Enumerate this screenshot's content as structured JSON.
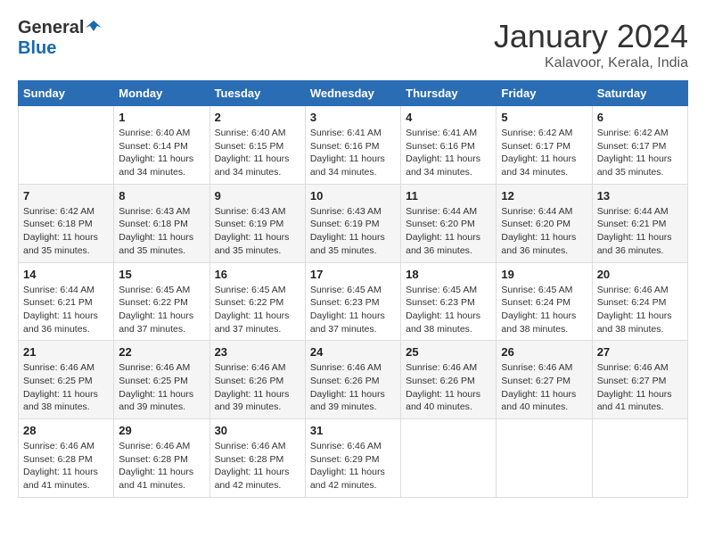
{
  "header": {
    "logo_general": "General",
    "logo_blue": "Blue",
    "month": "January 2024",
    "location": "Kalavoor, Kerala, India"
  },
  "columns": [
    "Sunday",
    "Monday",
    "Tuesday",
    "Wednesday",
    "Thursday",
    "Friday",
    "Saturday"
  ],
  "weeks": [
    [
      {
        "day": "",
        "sunrise": "",
        "sunset": "",
        "daylight": ""
      },
      {
        "day": "1",
        "sunrise": "Sunrise: 6:40 AM",
        "sunset": "Sunset: 6:14 PM",
        "daylight": "Daylight: 11 hours and 34 minutes."
      },
      {
        "day": "2",
        "sunrise": "Sunrise: 6:40 AM",
        "sunset": "Sunset: 6:15 PM",
        "daylight": "Daylight: 11 hours and 34 minutes."
      },
      {
        "day": "3",
        "sunrise": "Sunrise: 6:41 AM",
        "sunset": "Sunset: 6:16 PM",
        "daylight": "Daylight: 11 hours and 34 minutes."
      },
      {
        "day": "4",
        "sunrise": "Sunrise: 6:41 AM",
        "sunset": "Sunset: 6:16 PM",
        "daylight": "Daylight: 11 hours and 34 minutes."
      },
      {
        "day": "5",
        "sunrise": "Sunrise: 6:42 AM",
        "sunset": "Sunset: 6:17 PM",
        "daylight": "Daylight: 11 hours and 34 minutes."
      },
      {
        "day": "6",
        "sunrise": "Sunrise: 6:42 AM",
        "sunset": "Sunset: 6:17 PM",
        "daylight": "Daylight: 11 hours and 35 minutes."
      }
    ],
    [
      {
        "day": "7",
        "sunrise": "Sunrise: 6:42 AM",
        "sunset": "Sunset: 6:18 PM",
        "daylight": "Daylight: 11 hours and 35 minutes."
      },
      {
        "day": "8",
        "sunrise": "Sunrise: 6:43 AM",
        "sunset": "Sunset: 6:18 PM",
        "daylight": "Daylight: 11 hours and 35 minutes."
      },
      {
        "day": "9",
        "sunrise": "Sunrise: 6:43 AM",
        "sunset": "Sunset: 6:19 PM",
        "daylight": "Daylight: 11 hours and 35 minutes."
      },
      {
        "day": "10",
        "sunrise": "Sunrise: 6:43 AM",
        "sunset": "Sunset: 6:19 PM",
        "daylight": "Daylight: 11 hours and 35 minutes."
      },
      {
        "day": "11",
        "sunrise": "Sunrise: 6:44 AM",
        "sunset": "Sunset: 6:20 PM",
        "daylight": "Daylight: 11 hours and 36 minutes."
      },
      {
        "day": "12",
        "sunrise": "Sunrise: 6:44 AM",
        "sunset": "Sunset: 6:20 PM",
        "daylight": "Daylight: 11 hours and 36 minutes."
      },
      {
        "day": "13",
        "sunrise": "Sunrise: 6:44 AM",
        "sunset": "Sunset: 6:21 PM",
        "daylight": "Daylight: 11 hours and 36 minutes."
      }
    ],
    [
      {
        "day": "14",
        "sunrise": "Sunrise: 6:44 AM",
        "sunset": "Sunset: 6:21 PM",
        "daylight": "Daylight: 11 hours and 36 minutes."
      },
      {
        "day": "15",
        "sunrise": "Sunrise: 6:45 AM",
        "sunset": "Sunset: 6:22 PM",
        "daylight": "Daylight: 11 hours and 37 minutes."
      },
      {
        "day": "16",
        "sunrise": "Sunrise: 6:45 AM",
        "sunset": "Sunset: 6:22 PM",
        "daylight": "Daylight: 11 hours and 37 minutes."
      },
      {
        "day": "17",
        "sunrise": "Sunrise: 6:45 AM",
        "sunset": "Sunset: 6:23 PM",
        "daylight": "Daylight: 11 hours and 37 minutes."
      },
      {
        "day": "18",
        "sunrise": "Sunrise: 6:45 AM",
        "sunset": "Sunset: 6:23 PM",
        "daylight": "Daylight: 11 hours and 38 minutes."
      },
      {
        "day": "19",
        "sunrise": "Sunrise: 6:45 AM",
        "sunset": "Sunset: 6:24 PM",
        "daylight": "Daylight: 11 hours and 38 minutes."
      },
      {
        "day": "20",
        "sunrise": "Sunrise: 6:46 AM",
        "sunset": "Sunset: 6:24 PM",
        "daylight": "Daylight: 11 hours and 38 minutes."
      }
    ],
    [
      {
        "day": "21",
        "sunrise": "Sunrise: 6:46 AM",
        "sunset": "Sunset: 6:25 PM",
        "daylight": "Daylight: 11 hours and 38 minutes."
      },
      {
        "day": "22",
        "sunrise": "Sunrise: 6:46 AM",
        "sunset": "Sunset: 6:25 PM",
        "daylight": "Daylight: 11 hours and 39 minutes."
      },
      {
        "day": "23",
        "sunrise": "Sunrise: 6:46 AM",
        "sunset": "Sunset: 6:26 PM",
        "daylight": "Daylight: 11 hours and 39 minutes."
      },
      {
        "day": "24",
        "sunrise": "Sunrise: 6:46 AM",
        "sunset": "Sunset: 6:26 PM",
        "daylight": "Daylight: 11 hours and 39 minutes."
      },
      {
        "day": "25",
        "sunrise": "Sunrise: 6:46 AM",
        "sunset": "Sunset: 6:26 PM",
        "daylight": "Daylight: 11 hours and 40 minutes."
      },
      {
        "day": "26",
        "sunrise": "Sunrise: 6:46 AM",
        "sunset": "Sunset: 6:27 PM",
        "daylight": "Daylight: 11 hours and 40 minutes."
      },
      {
        "day": "27",
        "sunrise": "Sunrise: 6:46 AM",
        "sunset": "Sunset: 6:27 PM",
        "daylight": "Daylight: 11 hours and 41 minutes."
      }
    ],
    [
      {
        "day": "28",
        "sunrise": "Sunrise: 6:46 AM",
        "sunset": "Sunset: 6:28 PM",
        "daylight": "Daylight: 11 hours and 41 minutes."
      },
      {
        "day": "29",
        "sunrise": "Sunrise: 6:46 AM",
        "sunset": "Sunset: 6:28 PM",
        "daylight": "Daylight: 11 hours and 41 minutes."
      },
      {
        "day": "30",
        "sunrise": "Sunrise: 6:46 AM",
        "sunset": "Sunset: 6:28 PM",
        "daylight": "Daylight: 11 hours and 42 minutes."
      },
      {
        "day": "31",
        "sunrise": "Sunrise: 6:46 AM",
        "sunset": "Sunset: 6:29 PM",
        "daylight": "Daylight: 11 hours and 42 minutes."
      },
      {
        "day": "",
        "sunrise": "",
        "sunset": "",
        "daylight": ""
      },
      {
        "day": "",
        "sunrise": "",
        "sunset": "",
        "daylight": ""
      },
      {
        "day": "",
        "sunrise": "",
        "sunset": "",
        "daylight": ""
      }
    ]
  ]
}
